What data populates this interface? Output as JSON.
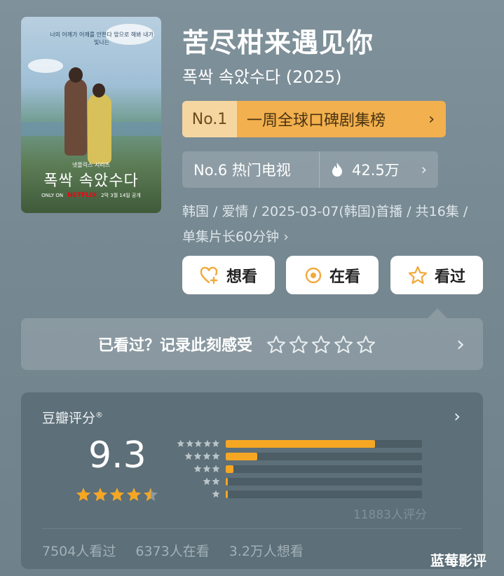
{
  "poster": {
    "tagline": "너의 어깨가 어깨를 안한다 앞으로 해봐 내가 빛나는",
    "small_top": "넷플릭스 시리즈",
    "title_ko": "폭싹 속았수다",
    "only_on": "ONLY ON",
    "netflix": "NETFLIX",
    "release": "2막 3월 14일 공개"
  },
  "title_cn": "苦尽柑来遇见你",
  "title_ko": "폭싹 속았수다 (2025)",
  "rank_gold": {
    "no": "No.1",
    "text": "一周全球口碑剧集榜",
    "chevron": "›"
  },
  "rank_hot": {
    "text": "No.6 热门电视",
    "heat": "42.5万",
    "chevron": "›"
  },
  "meta_text": "韩国 / 爱情 / 2025-03-07(韩国)首播 / 共16集 / 单集片长60分钟 ›",
  "buttons": {
    "want": "想看",
    "watching": "在看",
    "watched": "看过"
  },
  "record": {
    "label": "已看过？记录此刻感受",
    "chevron": "›"
  },
  "rating": {
    "title": "豆瓣评分",
    "reg": "®",
    "chevron": "›",
    "score": "9.3",
    "score_stars": 4.5,
    "distribution": [
      0.76,
      0.16,
      0.04,
      0.01,
      0.01
    ],
    "count": "11883人评分",
    "watched": "7504人看过",
    "watching": "6373人在看",
    "want": "3.2万人想看"
  },
  "colors": {
    "accent": "#f5a623",
    "gold_light": "#f6d6a0",
    "gold": "#f2b04e"
  },
  "watermark": "蓝莓影评"
}
